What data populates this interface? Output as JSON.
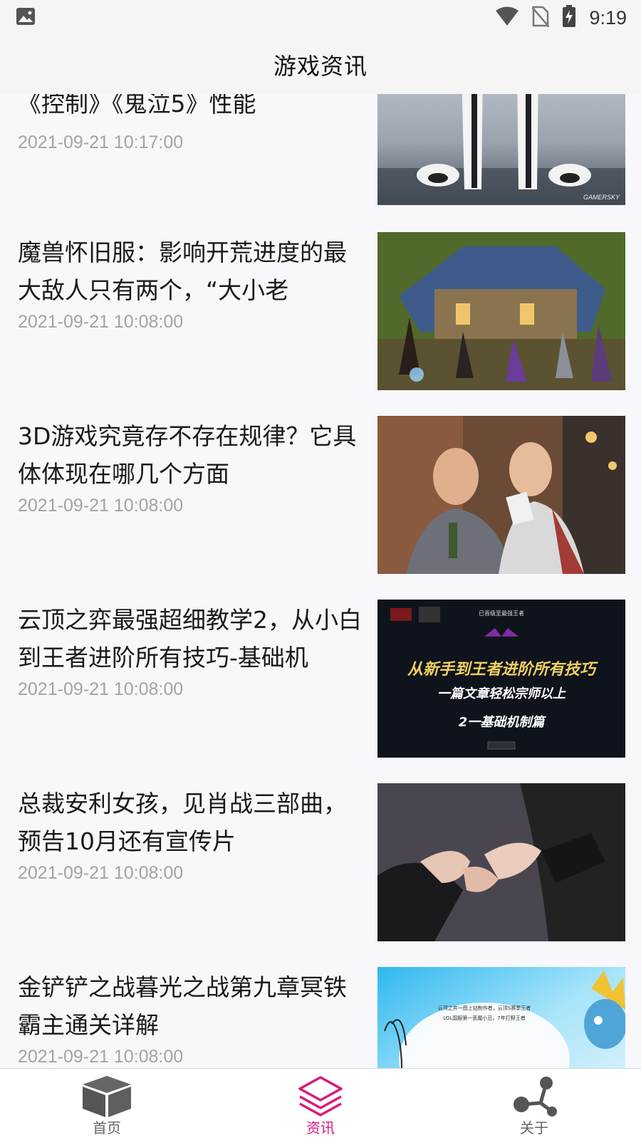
{
  "status_bar": {
    "time": "9:19",
    "icons": [
      "image-icon",
      "wifi-icon",
      "no-sim-icon",
      "battery-charging-icon"
    ]
  },
  "header": {
    "title": "游戏资讯"
  },
  "news": [
    {
      "title": "《控制》《鬼泣5》性能",
      "date": "2021-09-21 10:17:00",
      "thumb": "ps5-consoles",
      "watermark": "GAMERSKY"
    },
    {
      "title": "魔兽怀旧服：影响开荒进度的最大敌人只有两个，“大小老",
      "date": "2021-09-21 10:08:00",
      "thumb": "wow-characters"
    },
    {
      "title": "3D游戏究竟存不存在规律？它具体体现在哪几个方面",
      "date": "2021-09-21 10:08:00",
      "thumb": "two-men-gaming"
    },
    {
      "title": "云顶之弈最强超细教学2，从小白到王者进阶所有技巧-基础机",
      "date": "2021-09-21 10:08:00",
      "thumb": "tft-banner",
      "thumb_text": {
        "top": "已晋级至最强王者",
        "line1": "从新手到王者进阶所有技巧",
        "line2": "一篇文章轻松宗师以上",
        "line3": "2一基础机制篇"
      }
    },
    {
      "title": "总裁安利女孩，见肖战三部曲，预告10月还有宣传片",
      "date": "2021-09-21 10:08:00",
      "thumb": "hands-dark"
    },
    {
      "title": "金铲铲之战暮光之战第九章冥铁霸主通关详解",
      "date": "2021-09-21 10:08:00",
      "thumb": "tft-light-banner",
      "thumb_text": {
        "line1": "云顶之弈一图上钻制作者，云顶S赛季王者",
        "line2": "LOL国服第一恶魔小丑，7年打野王者"
      }
    }
  ],
  "bottom_nav": [
    {
      "label": "首页",
      "icon": "cube-icon",
      "active": false
    },
    {
      "label": "资讯",
      "icon": "layers-icon",
      "active": true
    },
    {
      "label": "关于",
      "icon": "share-nodes-icon",
      "active": false
    }
  ],
  "colors": {
    "accent": "#d81b7a",
    "background": "#f8f7fc",
    "date": "#a3a3a3"
  }
}
